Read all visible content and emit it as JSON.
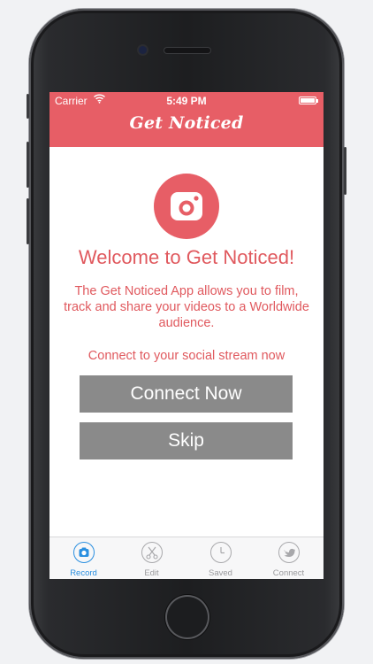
{
  "status_bar": {
    "carrier": "Carrier",
    "time": "5:49 PM"
  },
  "header": {
    "title": "Get Noticed"
  },
  "main": {
    "welcome": "Welcome to Get Noticed!",
    "description": "The Get Noticed App allows you to film, track and share your videos to a Worldwide audience.",
    "connect_prompt": "Connect to your social stream now",
    "connect_button": "Connect Now",
    "skip_button": "Skip"
  },
  "tabs": [
    {
      "label": "Record",
      "icon": "camera-icon",
      "active": true
    },
    {
      "label": "Edit",
      "icon": "scissors-icon",
      "active": false
    },
    {
      "label": "Saved",
      "icon": "clock-icon",
      "active": false
    },
    {
      "label": "Connect",
      "icon": "twitter-bird-icon",
      "active": false
    }
  ],
  "colors": {
    "brand": "#e75e66",
    "button": "#8a8a8a",
    "tab_active": "#2a8fe0",
    "tab_inactive": "#9a9a9d"
  }
}
